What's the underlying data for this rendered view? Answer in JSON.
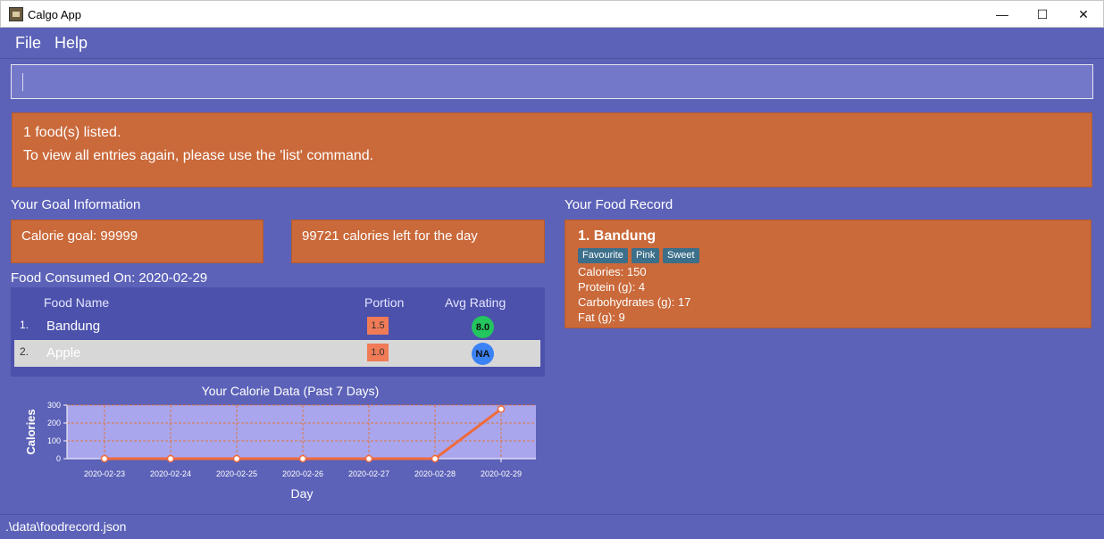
{
  "window": {
    "title": "Calgo App",
    "minimize_glyph": "—",
    "maximize_glyph": "☐",
    "close_glyph": "✕"
  },
  "menu": {
    "file": "File",
    "help": "Help"
  },
  "command_box": {
    "value": ""
  },
  "result": {
    "line1": "1 food(s) listed.",
    "line2": "To view all entries again, please use the 'list' command."
  },
  "goal": {
    "title": "Your Goal Information",
    "calorie_goal": "Calorie goal: 99999",
    "calories_left": "99721 calories left for the day"
  },
  "consumed": {
    "title": "Food Consumed On: 2020-02-29",
    "headers": {
      "name": "Food Name",
      "portion": "Portion",
      "rating": "Avg Rating"
    },
    "rows": [
      {
        "index": "1.",
        "name": "Bandung",
        "portion": "1.5",
        "rating": "8.0",
        "rating_color": "#22c55e"
      },
      {
        "index": "2.",
        "name": "Apple",
        "portion": "1.0",
        "rating": "NA",
        "rating_color": "#3b82f6"
      }
    ]
  },
  "chart_data": {
    "type": "line",
    "title": "Your Calorie Data (Past 7 Days)",
    "xlabel": "Day",
    "ylabel": "Calories",
    "x": [
      "2020-02-23",
      "2020-02-24",
      "2020-02-25",
      "2020-02-26",
      "2020-02-27",
      "2020-02-28",
      "2020-02-29"
    ],
    "values": [
      0,
      0,
      0,
      0,
      0,
      0,
      278
    ],
    "ylim": [
      0,
      300
    ],
    "yticks": [
      0,
      100,
      200,
      300
    ],
    "grid": true,
    "line_color": "#f06a3c",
    "plot_bg": "#a9a6ee"
  },
  "record": {
    "title": "Your Food Record",
    "food_name": "1.  Bandung",
    "tags": [
      "Favourite",
      "Pink",
      "Sweet"
    ],
    "calories": "Calories: 150",
    "protein": "Protein (g): 4",
    "carbs": "Carbohydrates (g): 17",
    "fat": "Fat (g): 9"
  },
  "status": {
    "path": ".\\data\\foodrecord.json"
  }
}
